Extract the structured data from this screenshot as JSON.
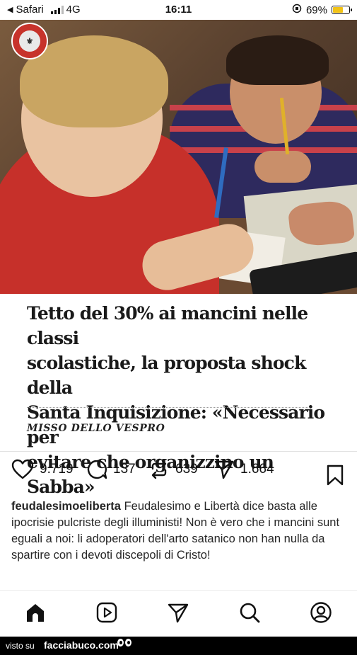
{
  "status_bar": {
    "back_app": "Safari",
    "network": "4G",
    "time": "16:11",
    "battery_percent": "69%",
    "battery_level": 0.69
  },
  "post_image": {
    "logo_alt": "Feudalesimo e Libertà"
  },
  "article": {
    "headline_lines": [
      "Tetto del 30% ai mancini nelle classi",
      "scolastiche, la proposta shock della",
      "Santa Inquisizione: «Necessario per",
      "evitare che organizzino un Sabba»"
    ],
    "author": "MISSO DELLO VESPRO"
  },
  "actions": {
    "likes": "9.719",
    "comments": "137",
    "reposts": "639",
    "shares": "1.664"
  },
  "caption": {
    "username": "feudalesimoeliberta",
    "text": "Feudalesimo e Libertà dice basta alle ipocrisie pulcriste degli illuministi! Non è vero che i mancini sunt eguali a noi: li adoperatori dell'arto satanico non han nulla da spartire con i devoti discepoli di Cristo!"
  },
  "tabbar": {
    "icons": [
      "home-icon",
      "reels-icon",
      "send-icon",
      "search-icon",
      "profile-icon"
    ]
  },
  "footer": {
    "prefix": "visto su",
    "site": "facciabuco.com"
  },
  "colors": {
    "battery": "#f2c316",
    "logo": "#c7332b",
    "footer_bg": "#000000"
  }
}
